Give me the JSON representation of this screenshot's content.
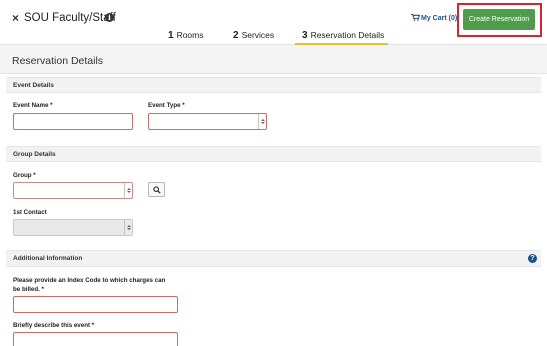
{
  "header": {
    "close_symbol": "×",
    "title": "SOU Faculty/Staff",
    "info_symbol": "i",
    "cart_label": "My Cart (0)",
    "create_button": "Create Reservation"
  },
  "steps": [
    {
      "number": "1",
      "label": "Rooms",
      "active": false
    },
    {
      "number": "2",
      "label": "Services",
      "active": false
    },
    {
      "number": "3",
      "label": "Reservation Details",
      "active": true
    }
  ],
  "page_heading": "Reservation Details",
  "sections": {
    "event_details": {
      "title": "Event Details",
      "event_name_label": "Event Name *",
      "event_name_value": "",
      "event_type_label": "Event Type *",
      "event_type_value": ""
    },
    "group_details": {
      "title": "Group Details",
      "group_label": "Group *",
      "group_value": "",
      "first_contact_label": "1st Contact",
      "first_contact_value": ""
    },
    "additional_information": {
      "title": "Additional Information",
      "help_symbol": "?",
      "index_code_label_line1": "Please provide an Index Code to which charges can",
      "index_code_label_line2": "be billed. *",
      "index_code_value": "",
      "describe_label": "Briefly describe this event *",
      "describe_value": ""
    }
  },
  "colors": {
    "create_button": "#4f9d4c",
    "highlight_outline": "#d9232e",
    "active_step_underline": "#e3c02e",
    "required_border": "#d36a6a",
    "cart_text": "#1f4f8b"
  }
}
